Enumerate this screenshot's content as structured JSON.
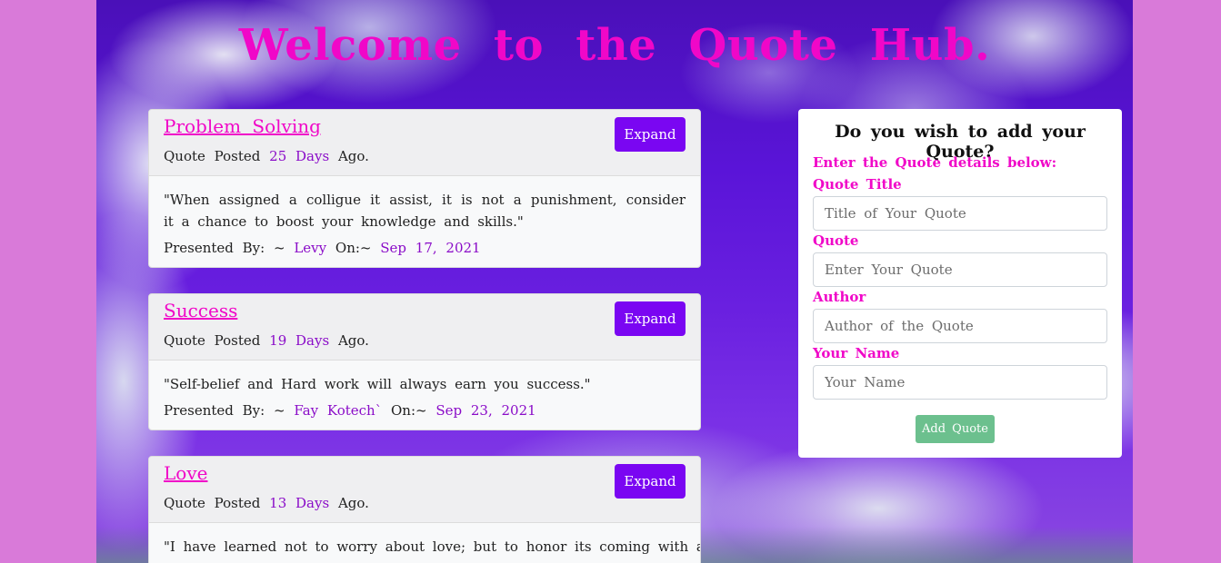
{
  "header": {
    "title": "Welcome to the Quote Hub."
  },
  "quotes": [
    {
      "title": "Problem Solving",
      "meta_prefix": "Quote Posted",
      "days": "25 Days",
      "meta_suffix": "Ago.",
      "expand_label": "Expand",
      "text": "\"When assigned a colligue it assist, it is not a punishment, consider it a chance to boost your knowledge and skills.\"",
      "presented_prefix": "Presented By: ~",
      "author": "Levy",
      "on_label": "On:~",
      "date": "Sep 17, 2021"
    },
    {
      "title": "Success",
      "meta_prefix": "Quote Posted",
      "days": "19 Days",
      "meta_suffix": "Ago.",
      "expand_label": "Expand",
      "text": "\"Self-belief and Hard work will always earn you success.\"",
      "presented_prefix": "Presented By: ~",
      "author": "Fay Kotech`",
      "on_label": "On:~",
      "date": "Sep 23, 2021"
    },
    {
      "title": "Love",
      "meta_prefix": "Quote Posted",
      "days": "13 Days",
      "meta_suffix": "Ago.",
      "expand_label": "Expand",
      "text": "\"I have learned not to worry about love; but to honor its coming with all"
    }
  ],
  "form": {
    "heading": "Do you wish to add your Quote?",
    "subheading": "Enter the Quote details below:",
    "fields": [
      {
        "label": "Quote Title",
        "placeholder": "Title of Your Quote"
      },
      {
        "label": "Quote",
        "placeholder": "Enter Your Quote"
      },
      {
        "label": "Author",
        "placeholder": "Author of the Quote"
      },
      {
        "label": "Your Name",
        "placeholder": "Your Name"
      }
    ],
    "submit_label": "Add Quote"
  },
  "colors": {
    "accent_pink": "#f007c8",
    "accent_purple": "#8a0cc8",
    "button_purple": "#7a06f2",
    "submit_green": "#6cc08e",
    "page_background": "#d97ad9"
  }
}
